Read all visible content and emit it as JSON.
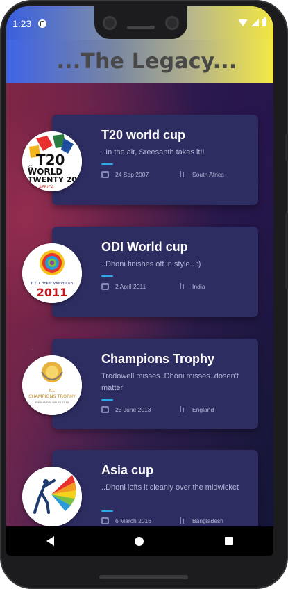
{
  "status": {
    "time": "1:23"
  },
  "app": {
    "title": "...The Legacy..."
  },
  "trophies": [
    {
      "title": "T20 world cup",
      "desc": "..In the air, Sreesanth takes it!!",
      "date": "24 Sep 2007",
      "venue": "South Africa",
      "logo": "t20-world-cup-logo",
      "logo_text": [
        "ICC",
        "WORLD",
        "TWENTY 20",
        "AFRICA"
      ]
    },
    {
      "title": "ODI World cup",
      "desc": "..Dhoni finishes off in style.. :)",
      "date": "2 April 2011",
      "venue": "India",
      "logo": "odi-world-cup-logo",
      "logo_text": [
        "ICC Cricket World Cup",
        "2011"
      ]
    },
    {
      "title": "Champions Trophy",
      "desc": "Trodowell misses..Dhoni misses..dosen't matter",
      "date": "23 June 2013",
      "venue": "England",
      "logo": "champions-trophy-logo",
      "logo_text": [
        "ICC",
        "CHAMPIONS TROPHY",
        "ENGLAND & WALES 2013"
      ]
    },
    {
      "title": "Asia cup",
      "desc": "..Dhoni lofts it cleanly over the midwicket",
      "date": "6 March 2016",
      "venue": "Bangladesh",
      "logo": "asia-cup-logo",
      "logo_text": []
    }
  ],
  "colors": {
    "card": "#2e2d62",
    "accent_line": "#2fa8ea",
    "header_start": "#3f63e6",
    "header_end": "#f4e945"
  },
  "icons": {
    "date": "calendar-icon",
    "venue": "location-icon"
  }
}
